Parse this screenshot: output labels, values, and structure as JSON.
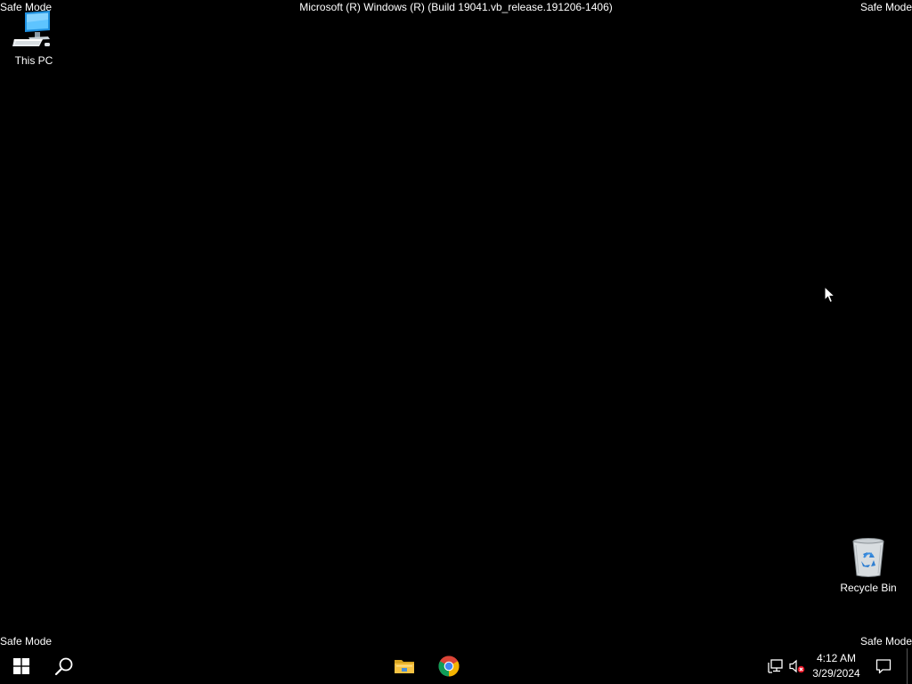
{
  "desktop": {
    "safe_mode_top_left": "Safe Mode",
    "safe_mode_top_right": "Safe Mode",
    "safe_mode_bottom_left": "Safe Mode",
    "safe_mode_bottom_right": "Safe Mode",
    "build_text": "Microsoft (R) Windows (R) (Build 19041.vb_release.191206-1406)",
    "background_color": "#000000",
    "icons": [
      {
        "label": "This PC",
        "icon": "computer-icon"
      },
      {
        "label": "Recycle Bin",
        "icon": "recycle-bin-icon"
      }
    ]
  },
  "taskbar": {
    "start_icon": "windows-logo-icon",
    "search_icon": "search-icon",
    "pinned": [
      {
        "icon": "file-explorer-icon"
      },
      {
        "icon": "chrome-icon"
      }
    ],
    "tray": {
      "network_icon": "network-icon",
      "volume_icon": "volume-muted-icon",
      "time": "4:12 AM",
      "date": "3/29/2024",
      "notification_icon": "action-center-icon"
    },
    "accent_color": "#0078d7"
  }
}
